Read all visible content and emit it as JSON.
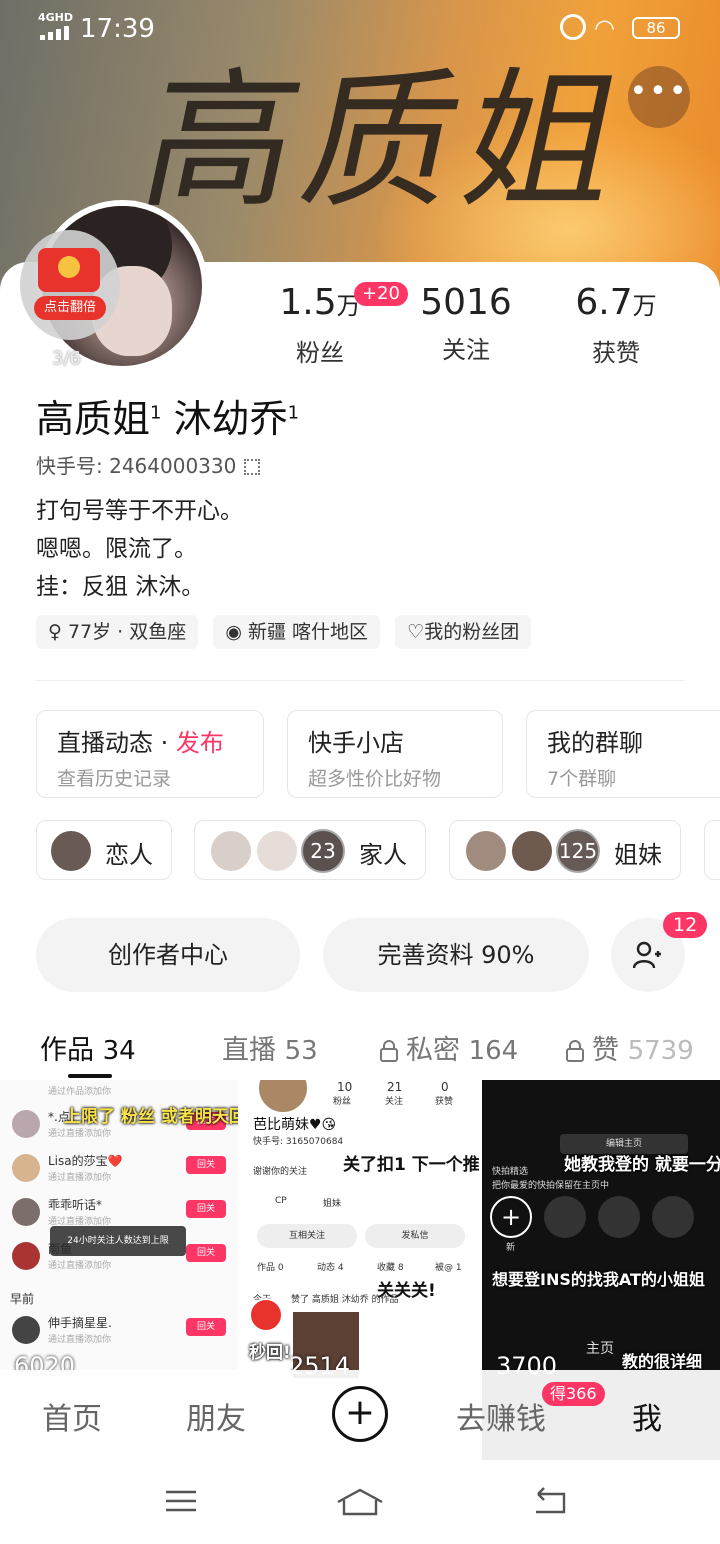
{
  "status_bar": {
    "network": "4GHD",
    "time": "17:39",
    "battery": "86"
  },
  "banner": {
    "calligraphy": "高质姐"
  },
  "profile": {
    "redpacket_label": "点击翻倍",
    "avatar_page": "3/6",
    "name_part1": "高质姐",
    "name_part2": "沐幼乔",
    "name_sup": "1",
    "uid": "快手号: 2464000330",
    "bio": [
      "打句号等于不开心。",
      "嗯嗯。限流了。",
      "挂：反狙 沐沐。"
    ],
    "tags": [
      {
        "icon": "gender-female-icon",
        "label": "77岁 · 双鱼座"
      },
      {
        "icon": "location-pin-icon",
        "label": "新疆 喀什地区"
      },
      {
        "icon": "fan-club-heart-icon",
        "label": "我的粉丝团"
      }
    ]
  },
  "stats": {
    "fans_value": "1.5",
    "fans_unit": "万",
    "fans_delta": "+20",
    "fans_label": "粉丝",
    "following_value": "5016",
    "following_label": "关注",
    "likes_value": "6.7",
    "likes_unit": "万",
    "likes_label": "获赞"
  },
  "features": [
    {
      "title": "直播动态",
      "sep": " · ",
      "highlight": "发布",
      "subtitle": "查看历史记录"
    },
    {
      "title": "快手小店",
      "highlight": "",
      "subtitle": "超多性价比好物"
    },
    {
      "title": "我的群聊",
      "highlight": "",
      "subtitle": "7个群聊"
    }
  ],
  "circles": [
    {
      "label": "恋人"
    },
    {
      "label": "家人",
      "count": "23"
    },
    {
      "label": "姐妹",
      "count": "125"
    }
  ],
  "actions": {
    "creator_center": "创作者中心",
    "complete_profile": "完善资料 90%",
    "add_friend_badge": "12"
  },
  "tabs": [
    {
      "label": "作品",
      "count": "34",
      "active": true
    },
    {
      "label": "直播",
      "count": "53"
    },
    {
      "label": "私密",
      "count": "164",
      "locked": true
    },
    {
      "label": "赞",
      "count": "5739",
      "locked": true
    }
  ],
  "grid": {
    "cell1": {
      "rows": [
        {
          "name": "通过作品添加你",
          "sub": ""
        },
        {
          "name": "*.点",
          "sub": "通过直播添加你",
          "btn": "回关"
        },
        {
          "name": "Lisa的莎宝❤️",
          "sub": "通过直播添加你",
          "btn": "回关"
        },
        {
          "name": "乖乖听话*",
          "sub": "通过直播添加你",
          "btn": "回关"
        },
        {
          "name": "雨鱼",
          "sub": "通过直播添加你",
          "btn": "回关"
        },
        {
          "name": "早前",
          "sub": ""
        },
        {
          "name": "伸手摘星星.",
          "sub": "通过直播添加你",
          "btn": "回关"
        }
      ],
      "caption": "上限了 粉丝 或者明天回 刷刷！！！",
      "toast": "24小时关注人数达到上限",
      "play_count": "6020"
    },
    "cell2": {
      "fans": "10",
      "fans_label": "粉丝",
      "follow": "21",
      "follow_label": "关注",
      "likes": "0",
      "likes_label": "获赞",
      "nickname": "芭比萌妹♥😘",
      "uid": "快手号: 3165070684",
      "caption": "关了扣1 下一个推",
      "greeting": "谢谢你的关注",
      "chip1": "CP",
      "chip2": "姐妹",
      "btn1": "互相关注",
      "btn2": "发私信",
      "tab_labels": [
        "作品 0",
        "动态 4",
        "收藏 8",
        "被@ 1"
      ],
      "caption2": "关关关!",
      "date": "今天",
      "liked": "赞了 高质姐 沐幼乔 的作品",
      "caption3": "秒回!",
      "play_count": "2514"
    },
    "cell3": {
      "edit": "编辑主页",
      "caption": "她教我登的 就要一分钟",
      "sub1": "快拍精选",
      "sub2": "把你最爱的快拍保留在主页中",
      "new_label": "新",
      "caption2": "想要登INS的找我AT的小姐姐",
      "homepage": "主页",
      "caption3": "教的很详细",
      "play_count": "3700"
    }
  },
  "bottom_nav": {
    "home": "首页",
    "friends": "朋友",
    "earn": "去赚钱",
    "earn_badge": "得366",
    "me": "我"
  },
  "colors": {
    "accent": "#fe3666",
    "text": "#222222",
    "muted": "#999999"
  }
}
